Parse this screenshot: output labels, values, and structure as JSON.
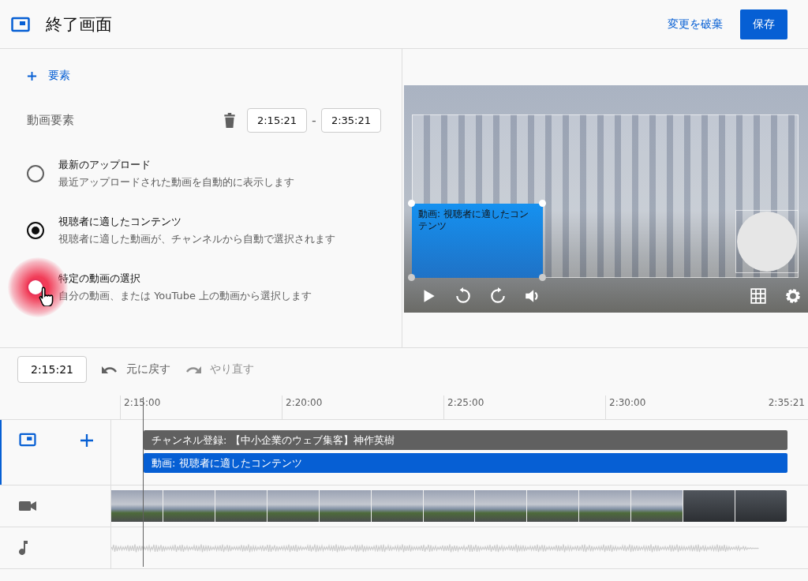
{
  "header": {
    "title": "終了画面",
    "discard_button": "変更を破棄",
    "save_button": "保存"
  },
  "add_element": "要素",
  "element": {
    "label": "動画要素",
    "start": "2:15:21",
    "separator": "-",
    "end": "2:35:21"
  },
  "options": [
    {
      "title": "最新のアップロード",
      "description": "最近アップロードされた動画を自動的に表示します",
      "selected": false,
      "pressed": false
    },
    {
      "title": "視聴者に適したコンテンツ",
      "description": "視聴者に適した動画が、チャンネルから自動で選択されます",
      "selected": true,
      "pressed": false
    },
    {
      "title": "特定の動画の選択",
      "description": "自分の動画、または YouTube 上の動画から選択します",
      "selected": false,
      "pressed": true
    }
  ],
  "preview": {
    "element_label": "動画: 視聴者に適したコンテンツ"
  },
  "toolbar": {
    "time": "2:15:21",
    "undo": "元に戻す",
    "redo": "やり直す"
  },
  "ruler": [
    "2:15:00",
    "2:20:00",
    "2:25:00",
    "2:30:00",
    "2:35:21"
  ],
  "tracks": [
    {
      "label": "チャンネル登録: 【中小企業のウェブ集客】神作英樹",
      "kind": "subscribe"
    },
    {
      "label": "動画: 視聴者に適したコンテンツ",
      "kind": "video"
    }
  ]
}
